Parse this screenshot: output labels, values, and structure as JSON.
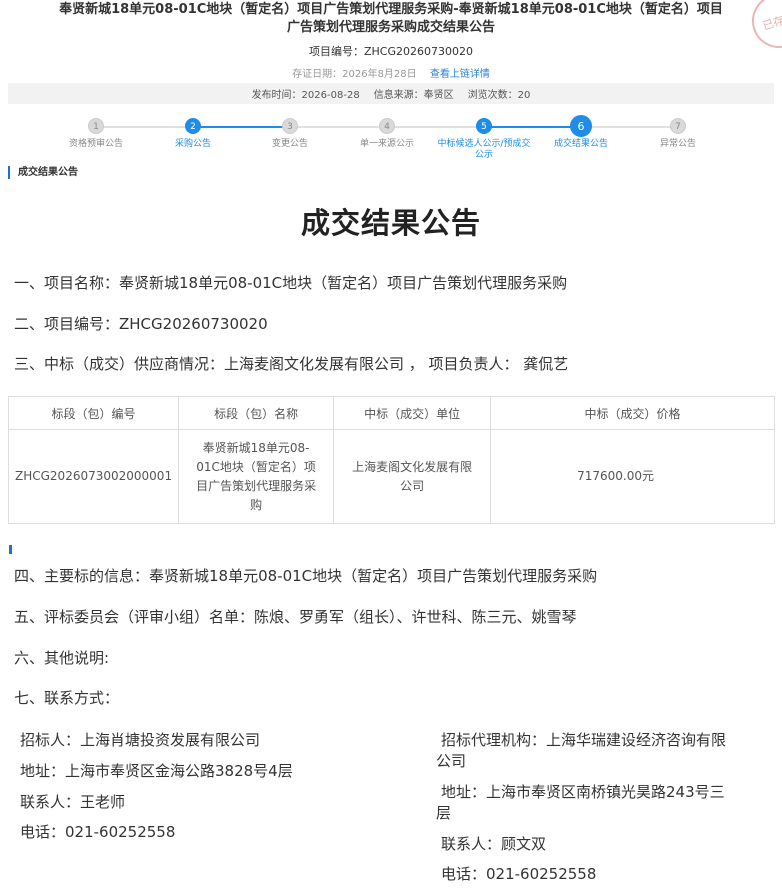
{
  "header": {
    "title_line1": "奉贤新城18单元08-01C地块（暂定名）项目广告策划代理服务采购-奉贤新城18单元08-01C地块（暂定名）项目",
    "title_line2": "广告策划代理服务采购成交结果公告",
    "project_no": "项目编号：ZHCG20260730020",
    "evidence_date": "存证日期：2026年8月28日",
    "evidence_link": "查看上链详情",
    "stamp_text": "已存"
  },
  "info_bar": {
    "publish_time": "发布时间：2026-08-28",
    "source": "信息来源：奉贤区",
    "views": "浏览次数：20"
  },
  "steps": [
    {
      "num": "1",
      "label": "资格预审公告",
      "state": "todo"
    },
    {
      "num": "2",
      "label": "采购公告",
      "state": "done"
    },
    {
      "num": "3",
      "label": "变更公告",
      "state": "todo"
    },
    {
      "num": "4",
      "label": "单一来源公示",
      "state": "todo"
    },
    {
      "num": "5",
      "label": "中标候选人公示/预成交公示",
      "state": "done"
    },
    {
      "num": "6",
      "label": "成交结果公告",
      "state": "current"
    },
    {
      "num": "7",
      "label": "异常公告",
      "state": "todo"
    }
  ],
  "section_tag": "成交结果公告",
  "main_title": "成交结果公告",
  "items": {
    "item1": "一、项目名称：奉贤新城18单元08-01C地块（暂定名）项目广告策划代理服务采购",
    "item2": "二、项目编号：ZHCG20260730020",
    "item3": "三、中标（成交）供应商情况：上海麦阁文化发展有限公司 ， 项目负责人： 龚侃艺",
    "item4": "四、主要标的信息：奉贤新城18单元08-01C地块（暂定名）项目广告策划代理服务采购",
    "item5": "五、评标委员会（评审小组）名单：陈烺、罗勇军（组长）、许世科、陈三元、姚雪琴",
    "item6": "六、其他说明:",
    "item7": "七、联系方式："
  },
  "table": {
    "headers": [
      "标段（包）编号",
      "标段（包）名称",
      "中标（成交）单位",
      "中标（成交）价格"
    ],
    "row": {
      "code": "ZHCG2026073002000001",
      "name_lines": [
        "奉贤新城18单元08-",
        "01C地块（暂定名）项",
        "目广告策划代理服务采",
        "购"
      ],
      "unit_lines": [
        "上海麦阁文化发展有限",
        "公司"
      ],
      "price": "717600.00元"
    }
  },
  "contacts": {
    "left": {
      "org": "招标人：上海肖塘投资发展有限公司",
      "address": "地址：上海市奉贤区金海公路3828号4层",
      "person": "联系人：王老师",
      "phone": "电话：021-60252558"
    },
    "right": {
      "org_line1": "招标代理机构：上海华瑞建设经济咨询有限",
      "org_line2": "公司",
      "address_line1": "地址：上海市奉贤区南桥镇光昊路243号三",
      "address_line2": "层",
      "person": "联系人：顾文双",
      "phone": "电话：021-60252558"
    }
  }
}
